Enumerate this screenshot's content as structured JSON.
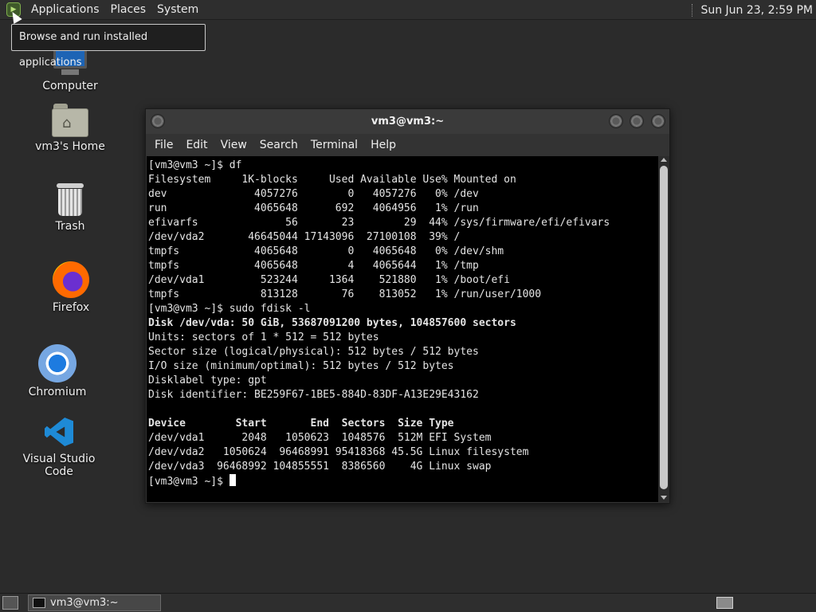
{
  "top_panel": {
    "menus": [
      "Applications",
      "Places",
      "System"
    ],
    "clock": "Sun Jun 23,  2:59 PM"
  },
  "tooltip": "Browse and run installed applications",
  "desktop_icons": [
    {
      "label": "Computer",
      "icon": "computer-icon"
    },
    {
      "label": "vm3's Home",
      "icon": "home-folder-icon"
    },
    {
      "label": "Trash",
      "icon": "trash-icon"
    },
    {
      "label": "Firefox",
      "icon": "firefox-icon"
    },
    {
      "label": "Chromium",
      "icon": "chromium-icon"
    },
    {
      "label": "Visual Studio Code",
      "icon": "vscode-icon"
    }
  ],
  "terminal": {
    "title": "vm3@vm3:~",
    "menu": [
      "File",
      "Edit",
      "View",
      "Search",
      "Terminal",
      "Help"
    ],
    "lines": [
      {
        "text": "[vm3@vm3 ~]$ df",
        "bold": false
      },
      {
        "text": "Filesystem     1K-blocks     Used Available Use% Mounted on",
        "bold": false
      },
      {
        "text": "dev              4057276        0   4057276   0% /dev",
        "bold": false
      },
      {
        "text": "run              4065648      692   4064956   1% /run",
        "bold": false
      },
      {
        "text": "efivarfs              56       23        29  44% /sys/firmware/efi/efivars",
        "bold": false
      },
      {
        "text": "/dev/vda2       46645044 17143096  27100108  39% /",
        "bold": false
      },
      {
        "text": "tmpfs            4065648        0   4065648   0% /dev/shm",
        "bold": false
      },
      {
        "text": "tmpfs            4065648        4   4065644   1% /tmp",
        "bold": false
      },
      {
        "text": "/dev/vda1         523244     1364    521880   1% /boot/efi",
        "bold": false
      },
      {
        "text": "tmpfs             813128       76    813052   1% /run/user/1000",
        "bold": false
      },
      {
        "text": "[vm3@vm3 ~]$ sudo fdisk -l",
        "bold": false
      },
      {
        "text": "Disk /dev/vda: 50 GiB, 53687091200 bytes, 104857600 sectors",
        "bold": true
      },
      {
        "text": "Units: sectors of 1 * 512 = 512 bytes",
        "bold": false
      },
      {
        "text": "Sector size (logical/physical): 512 bytes / 512 bytes",
        "bold": false
      },
      {
        "text": "I/O size (minimum/optimal): 512 bytes / 512 bytes",
        "bold": false
      },
      {
        "text": "Disklabel type: gpt",
        "bold": false
      },
      {
        "text": "Disk identifier: BE259F67-1BE5-884D-83DF-A13E29E43162",
        "bold": false
      },
      {
        "text": "",
        "bold": false
      },
      {
        "text": "Device        Start       End  Sectors  Size Type",
        "bold": true
      },
      {
        "text": "/dev/vda1      2048   1050623  1048576  512M EFI System",
        "bold": false
      },
      {
        "text": "/dev/vda2   1050624  96468991 95418368 45.5G Linux filesystem",
        "bold": false
      },
      {
        "text": "/dev/vda3  96468992 104855551  8386560    4G Linux swap",
        "bold": false
      }
    ],
    "prompt": "[vm3@vm3 ~]$ "
  },
  "taskbar": {
    "window_label": "vm3@vm3:~"
  }
}
